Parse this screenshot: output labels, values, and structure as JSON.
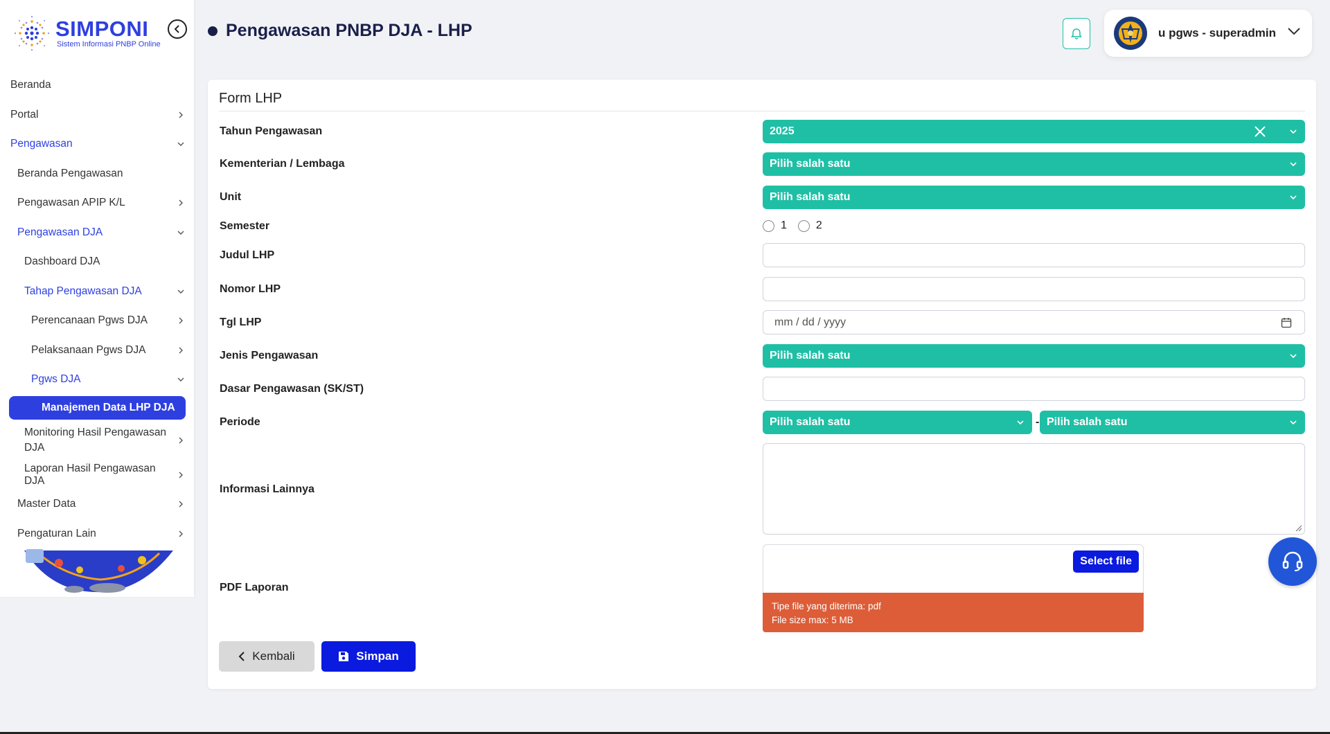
{
  "brand": {
    "name": "SIMPONI",
    "tagline": "Sistem Informasi PNBP Online"
  },
  "sidebar": {
    "items": [
      {
        "label": "Beranda",
        "level": 0
      },
      {
        "label": "Portal",
        "level": 0,
        "chevron": "right"
      },
      {
        "label": "Pengawasan",
        "level": 0,
        "chevron": "down",
        "active": true
      },
      {
        "label": "Beranda Pengawasan",
        "level": 1
      },
      {
        "label": "Pengawasan APIP K/L",
        "level": 1,
        "chevron": "right"
      },
      {
        "label": "Pengawasan DJA",
        "level": 1,
        "chevron": "down",
        "active": true
      },
      {
        "label": "Dashboard DJA",
        "level": 2
      },
      {
        "label": "Tahap Pengawasan DJA",
        "level": 2,
        "chevron": "down",
        "active": true
      },
      {
        "label": "Perencanaan Pgws DJA",
        "level": 3,
        "chevron": "right"
      },
      {
        "label": "Pelaksanaan Pgws DJA",
        "level": 3,
        "chevron": "right"
      },
      {
        "label": "Pgws DJA",
        "level": 3,
        "chevron": "down",
        "active": true
      },
      {
        "label": "Manajemen Data LHP DJA",
        "current": true
      },
      {
        "label": "Monitoring Hasil Pengawasan DJA",
        "level": 2,
        "chevron": "right"
      },
      {
        "label": "Laporan Hasil Pengawasan DJA",
        "level": 2,
        "chevron": "right"
      },
      {
        "label": "Master Data",
        "level": 1,
        "chevron": "right"
      },
      {
        "label": "Pengaturan Lain",
        "level": 1,
        "chevron": "right"
      }
    ]
  },
  "header": {
    "title": "Pengawasan PNBP DJA - LHP",
    "user": "u pgws - superadmin"
  },
  "form": {
    "title": "Form LHP",
    "tahun_label": "Tahun Pengawasan",
    "tahun_value": "2025",
    "kl_label": "Kementerian / Lembaga",
    "kl_value": "Pilih salah satu",
    "unit_label": "Unit",
    "unit_value": "Pilih salah satu",
    "semester_label": "Semester",
    "semester_options": [
      "1",
      "2"
    ],
    "judul_label": "Judul LHP",
    "judul_value": "",
    "nomor_label": "Nomor LHP",
    "nomor_value": "",
    "tgl_label": "Tgl LHP",
    "tgl_placeholder": "mm / dd / yyyy",
    "jenis_label": "Jenis Pengawasan",
    "jenis_value": "Pilih salah satu",
    "dasar_label": "Dasar Pengawasan (SK/ST)",
    "dasar_value": "",
    "periode_label": "Periode",
    "periode_start": "Pilih salah satu",
    "periode_sep": "-",
    "periode_end": "Pilih salah satu",
    "info_label": "Informasi Lainnya",
    "info_value": "",
    "pdf_label": "PDF Laporan",
    "select_file": "Select file",
    "file_type_info": "Tipe file yang diterima: pdf",
    "file_size_info": "File size max: 5 MB",
    "back_label": "Kembali",
    "save_label": "Simpan"
  },
  "colors": {
    "primary": "#2e3fe0",
    "button_primary": "#0a1adf",
    "select_teal": "#1fbfa5",
    "warning": "#dc5d38"
  },
  "icons": [
    "collapse-icon",
    "bell-icon",
    "emblem-icon",
    "chevron-down-icon",
    "chevron-right-icon",
    "close-icon",
    "calendar-icon",
    "save-icon",
    "chevron-left-icon",
    "headset-icon"
  ]
}
